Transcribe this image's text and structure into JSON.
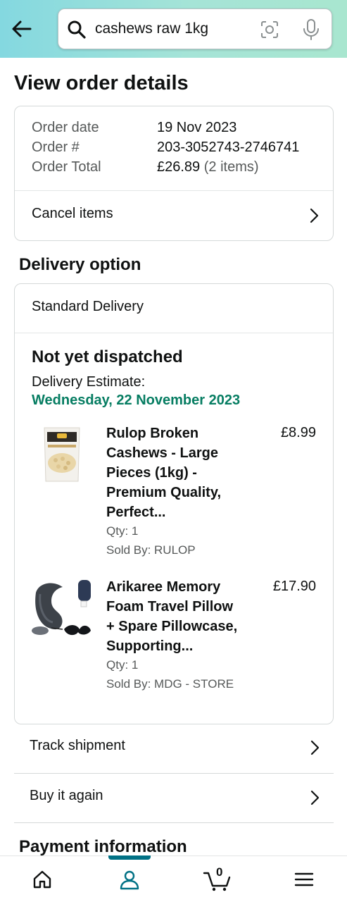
{
  "search": {
    "query": "cashews raw 1kg"
  },
  "page_title": "View order details",
  "order_summary": {
    "rows": [
      {
        "label": "Order date",
        "value": "19 Nov 2023"
      },
      {
        "label": "Order #",
        "value": "203-3052743-2746741"
      },
      {
        "label": "Order Total",
        "value": "£26.89",
        "extra": "(2 items)"
      }
    ],
    "cancel_label": "Cancel items"
  },
  "delivery": {
    "section_title": "Delivery option",
    "option": "Standard Delivery",
    "status": "Not yet dispatched",
    "estimate_label": "Delivery Estimate:",
    "estimate_date": "Wednesday, 22 November 2023",
    "items": [
      {
        "title_lines": [
          "Rulop Broken",
          "Cashews - Large",
          "Pieces (1kg) -",
          "Premium Quality,",
          "Perfect..."
        ],
        "price": "£8.99",
        "qty": "Qty: 1",
        "seller": "Sold By: RULOP",
        "image": "cashew-bag-image"
      },
      {
        "title_lines": [
          "Arikaree Memory",
          "Foam Travel Pillow",
          "+ Spare Pillowcase,",
          "Supporting..."
        ],
        "price": "£17.90",
        "qty": "Qty: 1",
        "seller": "Sold By: MDG - STORE",
        "image": "travel-pillow-image"
      }
    ]
  },
  "actions": {
    "track": "Track shipment",
    "buy_again": "Buy it again"
  },
  "payment": {
    "section_title": "Payment information"
  },
  "bottom_nav": {
    "cart_count": "0",
    "active": "account",
    "accent_color": "#007185"
  },
  "colors": {
    "delivery_green": "#067d62",
    "header_gradient_start": "#84d8e0",
    "header_gradient_end": "#a8e6cf"
  }
}
